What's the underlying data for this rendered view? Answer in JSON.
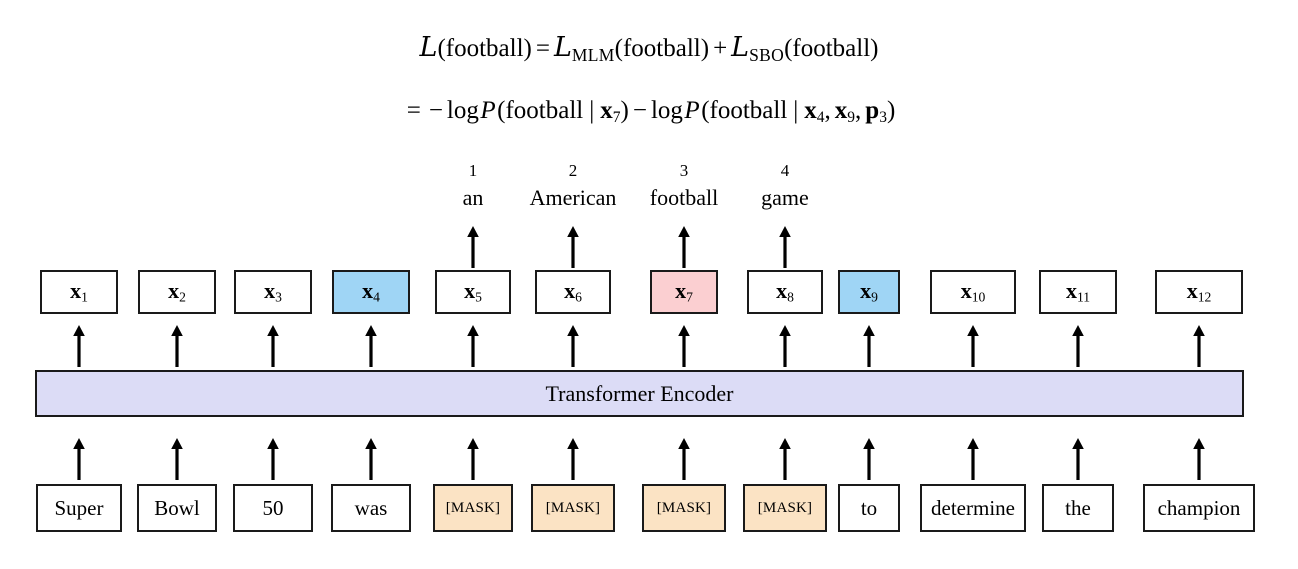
{
  "equations": {
    "line1": {
      "lhs_loss": "L",
      "lhs_arg": "(football)",
      "equals": "=",
      "term1_loss": "L",
      "term1_sub": "MLM",
      "term1_arg": "(football)",
      "plus": "+",
      "term2_loss": "L",
      "term2_sub": "SBO",
      "term2_arg": "(football)",
      "plain": "L(football) = L_MLM(football) + L_SBO(football)"
    },
    "line2": {
      "equals": "=",
      "minus": "−",
      "log1": "log",
      "p1": "P",
      "open1": "(football",
      "mid1": "|",
      "cond1_a": "x",
      "cond1_a_sub": "7",
      "close1": ")",
      "minus2": "−",
      "log2": "log",
      "p2": "P",
      "open2": "(football",
      "mid2": "|",
      "cond2_a": "x",
      "cond2_a_sub": "4",
      "comma1": ",",
      "cond2_b": "x",
      "cond2_b_sub": "9",
      "comma2": ",",
      "cond2_c": "p",
      "cond2_c_sub": "3",
      "close2": ")",
      "plain": "= − log P(football | x_7) − log P(football | x_4, x_9, p_3)"
    }
  },
  "outputs": [
    {
      "index": "1",
      "word": "an"
    },
    {
      "index": "2",
      "word": "American"
    },
    {
      "index": "3",
      "word": "football"
    },
    {
      "index": "4",
      "word": "game"
    }
  ],
  "vectors": [
    {
      "symbol": "x",
      "sub": "1",
      "color": "white"
    },
    {
      "symbol": "x",
      "sub": "2",
      "color": "white"
    },
    {
      "symbol": "x",
      "sub": "3",
      "color": "white"
    },
    {
      "symbol": "x",
      "sub": "4",
      "color": "blue"
    },
    {
      "symbol": "x",
      "sub": "5",
      "color": "white"
    },
    {
      "symbol": "x",
      "sub": "6",
      "color": "white"
    },
    {
      "symbol": "x",
      "sub": "7",
      "color": "pink"
    },
    {
      "symbol": "x",
      "sub": "8",
      "color": "white"
    },
    {
      "symbol": "x",
      "sub": "9",
      "color": "blue"
    },
    {
      "symbol": "x",
      "sub": "10",
      "color": "white"
    },
    {
      "symbol": "x",
      "sub": "11",
      "color": "white"
    },
    {
      "symbol": "x",
      "sub": "12",
      "color": "white"
    }
  ],
  "encoder": {
    "label": "Transformer Encoder"
  },
  "tokens": [
    {
      "text": "Super",
      "color": "white"
    },
    {
      "text": "Bowl",
      "color": "white"
    },
    {
      "text": "50",
      "color": "white"
    },
    {
      "text": "was",
      "color": "white"
    },
    {
      "text": "[MASK]",
      "color": "tan"
    },
    {
      "text": "[MASK]",
      "color": "tan"
    },
    {
      "text": "[MASK]",
      "color": "tan"
    },
    {
      "text": "[MASK]",
      "color": "tan"
    },
    {
      "text": "to",
      "color": "white"
    },
    {
      "text": "determine",
      "color": "white"
    },
    {
      "text": "the",
      "color": "white"
    },
    {
      "text": "champion",
      "color": "white"
    }
  ],
  "colors": {
    "blue_box": "#9fd5f5",
    "pink_box": "#fbcfd1",
    "tan_box": "#fbe3c4",
    "encoder_fill": "#dcdcf6",
    "border": "#1a1a1a",
    "page_background": "#ffffff",
    "text": "#000000"
  }
}
